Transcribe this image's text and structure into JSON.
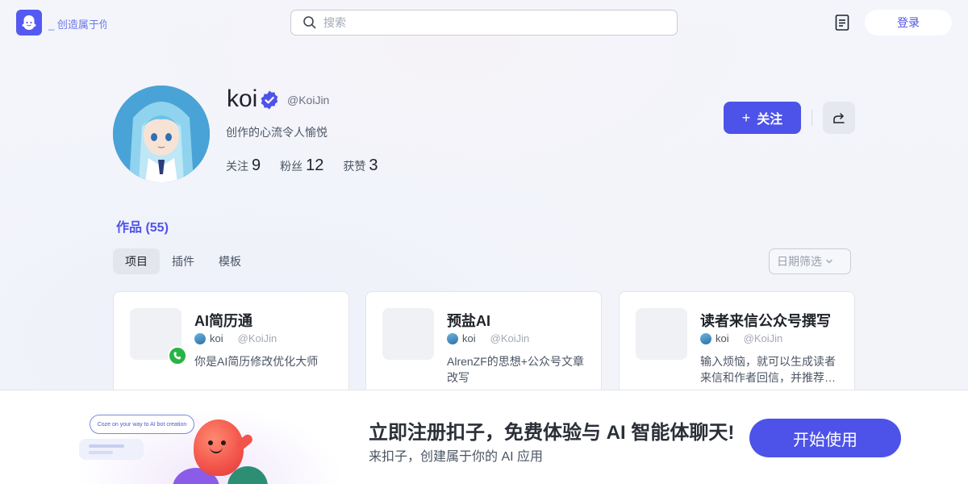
{
  "header": {
    "brand_text": "_ 创造属于你",
    "search_placeholder": "搜索",
    "login_label": "登录"
  },
  "profile": {
    "name": "koi",
    "handle": "@KoiJin",
    "bio": "创作的心流令人愉悦",
    "stats": [
      {
        "label": "关注",
        "value": "9"
      },
      {
        "label": "粉丝",
        "value": "12"
      },
      {
        "label": "获赞",
        "value": "3"
      }
    ],
    "follow_label": "关注",
    "follow_plus": "+"
  },
  "works": {
    "title": "作品 (55)",
    "tabs": [
      "项目",
      "插件",
      "模板"
    ],
    "date_filter": "日期筛选",
    "cards": [
      {
        "title": "AI简历通",
        "author": "koi",
        "handle": "@KoiJin",
        "desc": "你是AI简历修改优化大师"
      },
      {
        "title": "预盐AI",
        "author": "koi",
        "handle": "@KoiJin",
        "desc": "AlrenZF的思想+公众号文章改写"
      },
      {
        "title": "读者来信公众号撰写",
        "author": "koi",
        "handle": "@KoiJin",
        "desc": "输入烦恼，就可以生成读者来信和作者回信，并推荐…"
      }
    ]
  },
  "banner": {
    "bubble_text": "Coze on your way to AI bot creation",
    "title": "立即注册扣子，免费体验与 AI 智能体聊天!",
    "subtitle": "来扣子，创建属于你的 AI 应用",
    "cta": "开始使用"
  },
  "colors": {
    "accent": "#4d53e8",
    "badge_green": "#28b446"
  }
}
